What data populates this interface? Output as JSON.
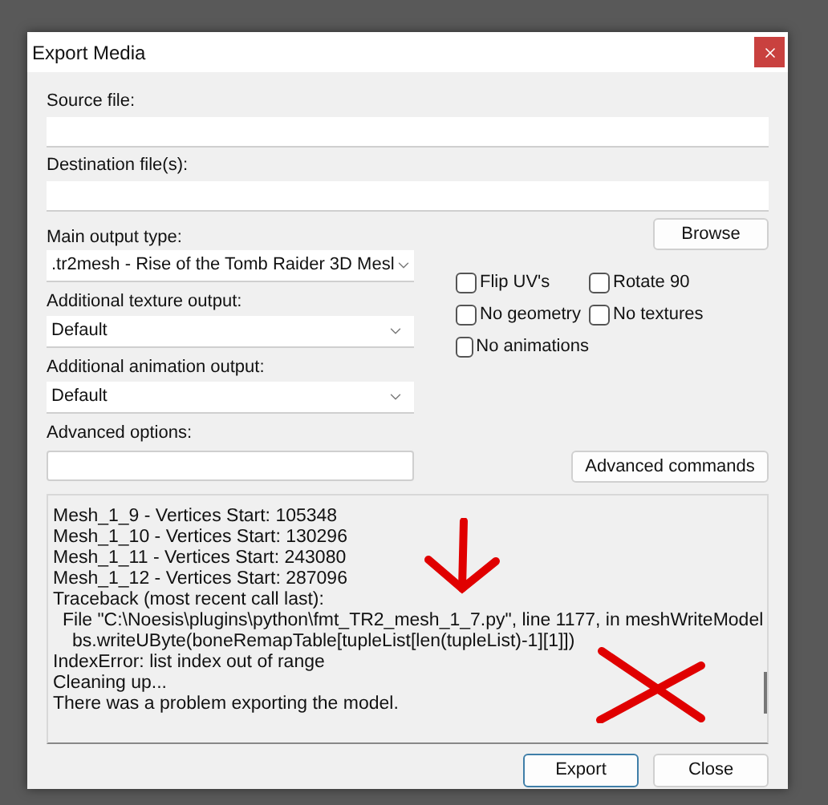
{
  "window": {
    "title": "Export Media"
  },
  "source_file": {
    "label": "Source file:"
  },
  "destination_file": {
    "label": "Destination file(s):"
  },
  "browse_button": "Browse",
  "main_output_type": {
    "label": "Main output type:",
    "value": ".tr2mesh - Rise of the Tomb Raider 3D Mesl"
  },
  "texture_output": {
    "label": "Additional texture output:",
    "value": "Default"
  },
  "animation_output": {
    "label": "Additional animation output:",
    "value": "Default"
  },
  "advanced_options": {
    "label": "Advanced options:"
  },
  "checkboxes": [
    {
      "label": "Flip UV's",
      "checked": false
    },
    {
      "label": "Rotate 90",
      "checked": false
    },
    {
      "label": "No geometry",
      "checked": false
    },
    {
      "label": "No textures",
      "checked": false
    },
    {
      "label": "No animations",
      "checked": false
    }
  ],
  "advanced_commands_button": "Advanced commands",
  "log": [
    {
      "text": "Mesh_1_9 - Vertices Start: 105348"
    },
    {
      "text": "Mesh_1_10 - Vertices Start: 130296"
    },
    {
      "text": "Mesh_1_11 - Vertices Start: 243080"
    },
    {
      "text": "Mesh_1_12 - Vertices Start: 287096"
    },
    {
      "text": "Traceback (most recent call last):",
      "children": [
        {
          "text": "File \"C:\\Noesis\\plugins\\python\\fmt_TR2_mesh_1_7.py\", line 1177, in meshWriteModel",
          "children": [
            {
              "text": "bs.writeUByte(boneRemapTable[tupleList[len(tupleList)-1][1]])"
            }
          ]
        }
      ]
    },
    {
      "text": "IndexError: list index out of range"
    },
    {
      "text": "Cleaning up..."
    },
    {
      "text": "There was a problem exporting the model."
    }
  ],
  "buttons": [
    {
      "label": "Export",
      "selected": true
    },
    {
      "label": "Close",
      "selected": false
    }
  ]
}
